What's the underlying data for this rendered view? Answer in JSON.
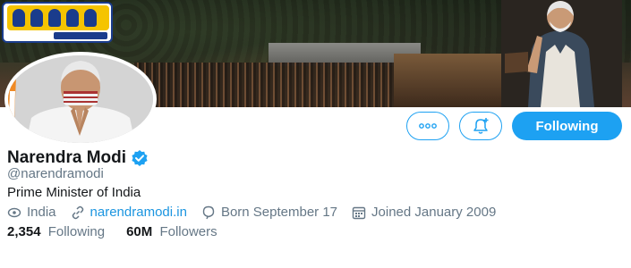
{
  "banner": {
    "logo_text": "కంప్యూటర్ విజ్ఞానం"
  },
  "profile": {
    "name": "Narendra Modi",
    "verified_icon": "verified-badge-icon",
    "handle": "@narendramodi",
    "bio": "Prime Minister of India",
    "location": "India",
    "website": "narendramodi.in",
    "birthday": "Born September 17",
    "joined": "Joined January 2009"
  },
  "actions": {
    "more_icon": "more-horizontal-icon",
    "notify_icon": "bell-plus-icon",
    "following_label": "Following"
  },
  "stats": {
    "following_count": "2,354",
    "following_label": "Following",
    "followers_count": "60M",
    "followers_label": "Followers"
  },
  "colors": {
    "accent": "#1da1f2",
    "link": "#1b95e0",
    "muted": "#657786",
    "text": "#14171a"
  }
}
